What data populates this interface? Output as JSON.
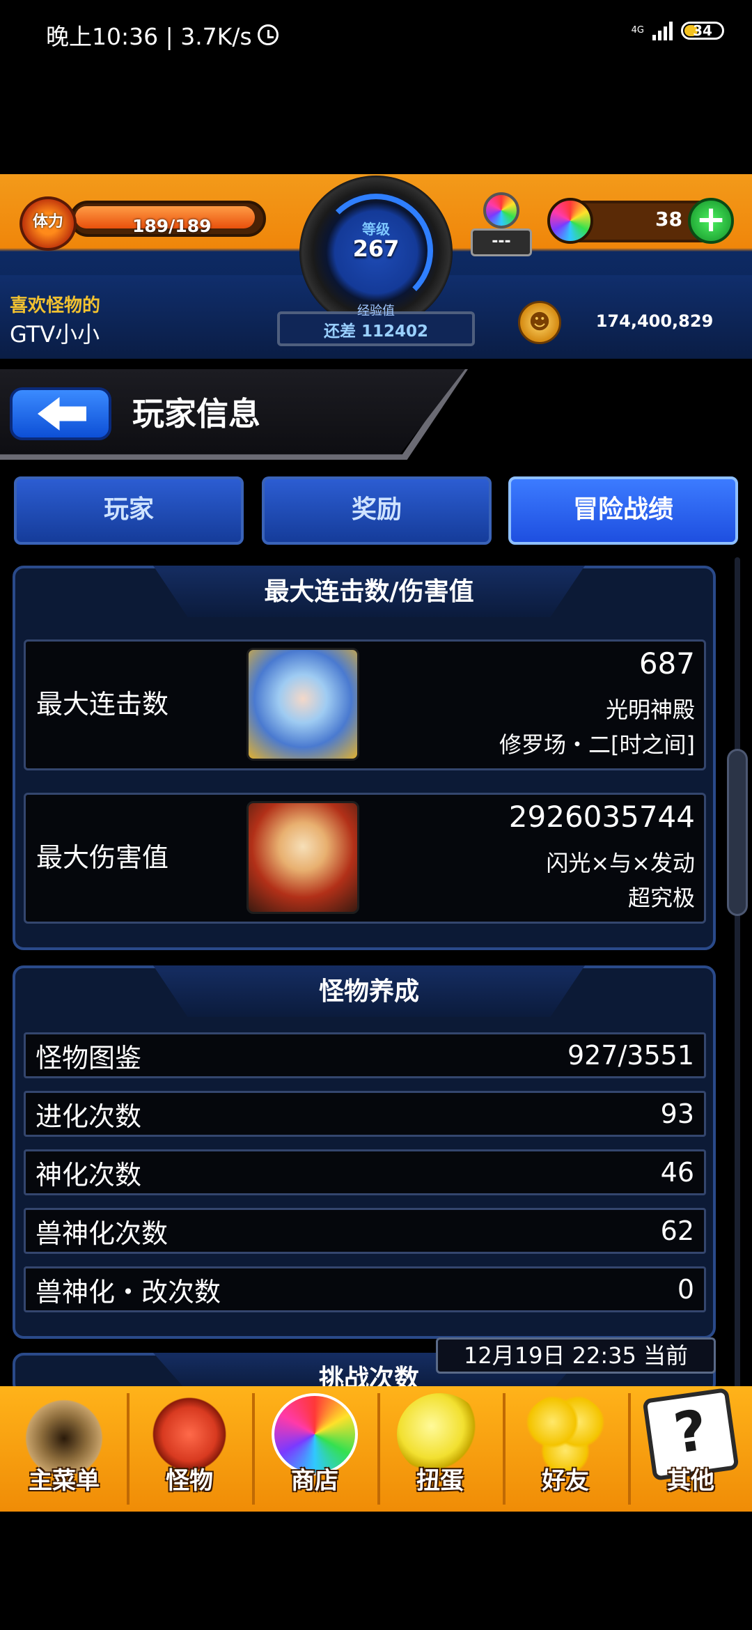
{
  "status_bar": {
    "time_speed": "晚上10:36 | 3.7K/s",
    "network": "4G",
    "battery": "34"
  },
  "header": {
    "stamina_label": "体力",
    "stamina_value": "189/189",
    "level_label": "等级",
    "level_value": "267",
    "exp_label": "经验值",
    "exp_remaining": "还差 112402",
    "orb_holder_value": "---",
    "orb_count": "38",
    "player_subtitle": "喜欢怪物的",
    "player_name": "GTV小小",
    "coin_value": "174,400,829"
  },
  "title_bar": {
    "title": "玩家信息"
  },
  "tabs": [
    {
      "label": "玩家",
      "active": false
    },
    {
      "label": "奖励",
      "active": false
    },
    {
      "label": "冒险战绩",
      "active": true
    }
  ],
  "records_panel": {
    "heading": "最大连击数/伤害值",
    "rows": [
      {
        "label": "最大连击数",
        "value": "687",
        "sub1": "光明神殿",
        "sub2": "修罗场・二[时之间]"
      },
      {
        "label": "最大伤害值",
        "value": "2926035744",
        "sub1": "闪光×与×发动",
        "sub2": "超究极"
      }
    ]
  },
  "training_panel": {
    "heading": "怪物养成",
    "rows": [
      {
        "label": "怪物图鉴",
        "value": "927/3551"
      },
      {
        "label": "进化次数",
        "value": "93"
      },
      {
        "label": "神化次数",
        "value": "46"
      },
      {
        "label": "兽神化次数",
        "value": "62"
      },
      {
        "label": "兽神化・改次数",
        "value": "0"
      }
    ]
  },
  "next_panel": {
    "heading": "挑战次数"
  },
  "timestamp": "12月19日 22:35 当前",
  "bottom_nav": [
    {
      "label": "主菜单",
      "icon": "gate-icon"
    },
    {
      "label": "怪物",
      "icon": "dragon-icon"
    },
    {
      "label": "商店",
      "icon": "rainbow-orb-icon"
    },
    {
      "label": "扭蛋",
      "icon": "egg-icon"
    },
    {
      "label": "好友",
      "icon": "balloons-icon"
    },
    {
      "label": "其他",
      "icon": "question-icon"
    }
  ],
  "colors": {
    "header_orange": "#f0860a",
    "header_blue": "#0b2150",
    "tab_active": "#1e4fe0",
    "panel_bg": "#0c1a36",
    "nav_orange": "#ffb31a"
  }
}
